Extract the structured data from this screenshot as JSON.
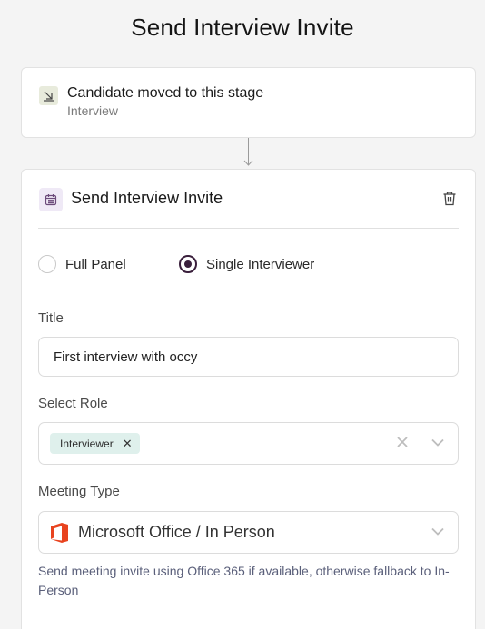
{
  "page": {
    "title": "Send Interview Invite"
  },
  "trigger": {
    "title": "Candidate moved to this stage",
    "subtitle": "Interview",
    "icon": "arrow-down-right-icon"
  },
  "action": {
    "title": "Send Interview Invite",
    "icon": "calendar-icon",
    "delete_icon": "trash-icon",
    "panel_options": [
      {
        "label": "Full Panel",
        "checked": false
      },
      {
        "label": "Single Interviewer",
        "checked": true
      }
    ],
    "title_field": {
      "label": "Title",
      "value": "First interview with occy"
    },
    "role_field": {
      "label": "Select Role",
      "selected": [
        "Interviewer"
      ]
    },
    "meeting_field": {
      "label": "Meeting Type",
      "value": "Microsoft Office / In Person",
      "icon": "microsoft-office-icon",
      "helper": "Send meeting invite using Office 365 if available, otherwise fallback to In-Person"
    }
  },
  "colors": {
    "background": "#f4f4f4",
    "radio_selected": "#3a1f3c",
    "chip_bg": "#dff0ec",
    "office_red": "#e8431f",
    "helper_text": "#5a5f7a"
  }
}
